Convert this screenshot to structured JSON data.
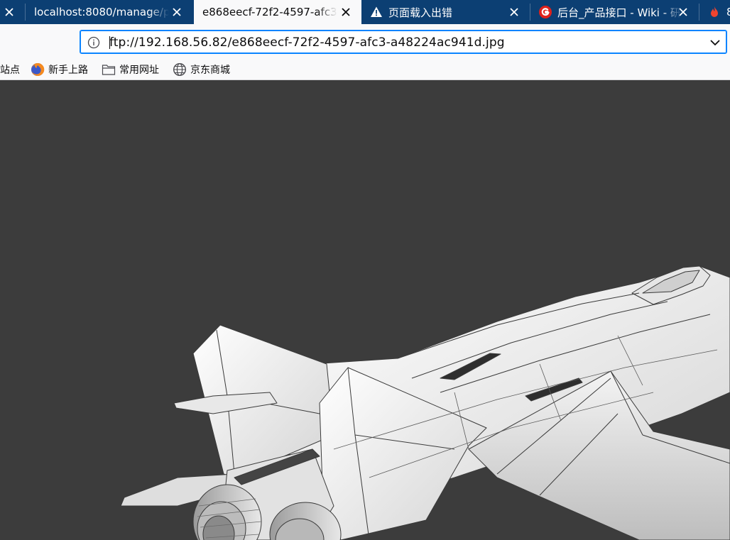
{
  "browser": {
    "tabs": [
      {
        "title": "localhost:8080/manage/pr",
        "active": false
      },
      {
        "title": "e868eecf-72f2-4597-afc3-a",
        "active": true
      },
      {
        "title": "页面载入出错",
        "active": false,
        "icon": "warning-icon"
      },
      {
        "title": "后台_产品接口 - Wiki - 研",
        "active": false,
        "icon": "g-logo-icon"
      },
      {
        "title": "8",
        "active": false,
        "icon": "flame-icon"
      }
    ],
    "address": {
      "url": "ftp://192.168.56.82/e868eecf-72f2-4597-afc3-a48224ac941d.jpg"
    },
    "bookmarks": [
      {
        "label": "站点",
        "icon": ""
      },
      {
        "label": "新手上路",
        "icon": "firefox-icon"
      },
      {
        "label": "常用网址",
        "icon": "folder-icon"
      },
      {
        "label": "京东商城",
        "icon": "globe-icon"
      }
    ]
  },
  "content": {
    "image_subject": "fighter-jet-3d-model",
    "background_color": "#3c3c3c"
  },
  "colors": {
    "tabbar": "#0c3f73",
    "active_tab": "#f9f9fa",
    "focus_ring": "#0a84ff"
  }
}
